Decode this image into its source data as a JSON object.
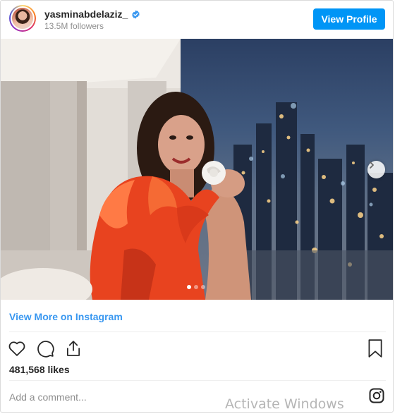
{
  "header": {
    "username": "yasminabdelaziz_",
    "followers": "13.5M followers",
    "view_profile_label": "View Profile"
  },
  "carousel": {
    "total_slides": 3,
    "active_slide": 1
  },
  "links": {
    "view_more": "View More on Instagram"
  },
  "stats": {
    "likes": "481,568 likes"
  },
  "comment": {
    "placeholder": "Add a comment..."
  },
  "watermark": {
    "text": "Activate Windows"
  },
  "colors": {
    "accent": "#0095f6",
    "link": "#3897f0",
    "dress": "#e8431f"
  },
  "icons": {
    "verified": "verified-badge-icon",
    "like": "heart-icon",
    "comment": "comment-icon",
    "share": "share-icon",
    "save": "bookmark-icon",
    "next": "chevron-right-icon",
    "brand": "instagram-icon"
  }
}
